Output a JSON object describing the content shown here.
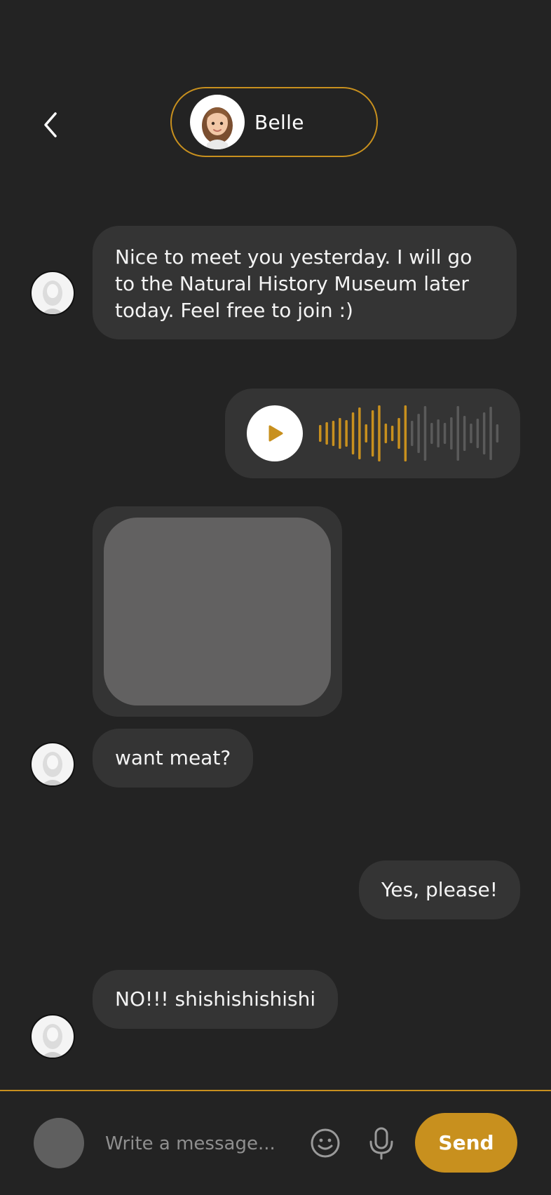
{
  "header": {
    "back_icon": "chevron-left-icon",
    "contact_name": "Belle"
  },
  "messages": [
    {
      "type": "text",
      "from": "them",
      "text": "Nice to meet you yesterday. I will go to the Natural History Museum later today. Feel free to join :)"
    },
    {
      "type": "voice",
      "from": "me",
      "played_fraction": 0.5
    },
    {
      "type": "image",
      "from": "them"
    },
    {
      "type": "text",
      "from": "them",
      "text": "want meat?"
    },
    {
      "type": "text",
      "from": "me",
      "text": "Yes, please!"
    },
    {
      "type": "text",
      "from": "them",
      "text": "NO!!! shishishishishi"
    }
  ],
  "composer": {
    "placeholder": "Write a message...",
    "send_label": "Send",
    "emoji_icon": "smiley-icon",
    "mic_icon": "microphone-icon"
  },
  "colors": {
    "background": "#232323",
    "bubble": "#343434",
    "accent": "#C8901E",
    "image_placeholder": "#626161"
  }
}
